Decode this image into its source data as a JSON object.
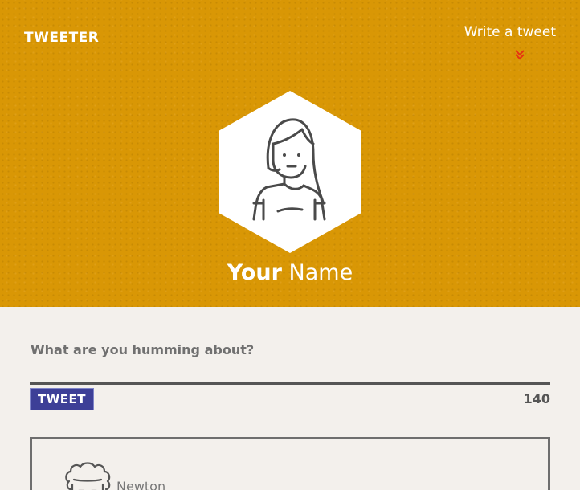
{
  "header": {
    "logo_text": "TWEETER",
    "write_link_label": "Write a tweet",
    "chevron_icon": "double-chevron-down-icon",
    "chevron_color": "#e63312"
  },
  "profile": {
    "first_name": "Your",
    "last_name": "Name",
    "avatar_icon": "woman-avatar-icon",
    "hero_color": "#d99705"
  },
  "compose": {
    "label": "What are you humming about?",
    "input_value": "",
    "tweet_button_label": "TWEET",
    "char_count": "140",
    "button_color": "#3d3f97"
  },
  "feed": {
    "tweets": [
      {
        "author": "Newton",
        "avatar_icon": "curly-hair-avatar-icon"
      }
    ]
  }
}
